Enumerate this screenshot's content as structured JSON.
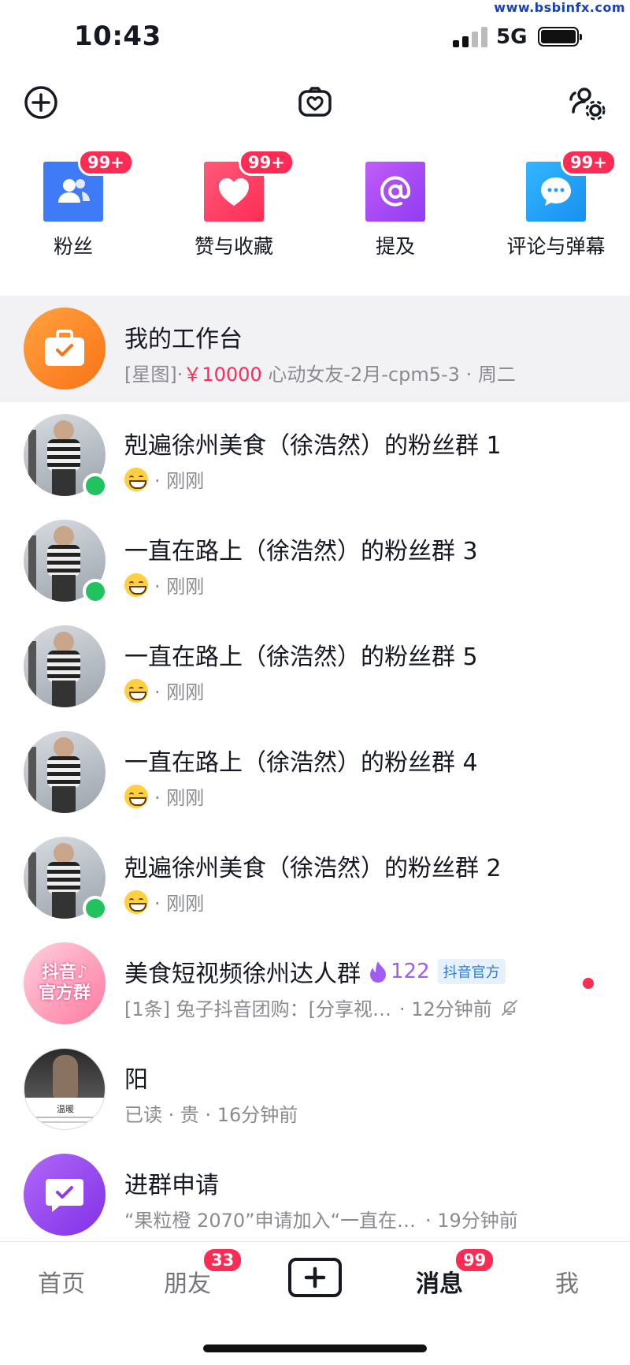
{
  "watermark": "www.bsbinfx.com",
  "status_bar": {
    "time": "10:43",
    "network": "5G"
  },
  "categories": [
    {
      "label": "粉丝",
      "badge": "99+",
      "icon": "fans-icon",
      "color": "#3f7bf6"
    },
    {
      "label": "赞与收藏",
      "badge": "99+",
      "icon": "heart-icon",
      "color": "#fe2c55"
    },
    {
      "label": "提及",
      "badge": "",
      "icon": "at-icon",
      "color": "#a94cf5"
    },
    {
      "label": "评论与弹幕",
      "badge": "99+",
      "icon": "comment-icon",
      "color": "#21a0f6"
    }
  ],
  "workbench": {
    "title": "我的工作台",
    "sub_prefix": "[星图]·",
    "sub_price": "￥10000",
    "sub_rest": " 心动女友-2月-cpm5-3 · 周二"
  },
  "conversations": [
    {
      "title": "剋遍徐州美食（徐浩然）的粉丝群 1",
      "time": "· 刚刚",
      "online": true
    },
    {
      "title": "一直在路上（徐浩然）的粉丝群 3",
      "time": "· 刚刚",
      "online": true
    },
    {
      "title": "一直在路上（徐浩然）的粉丝群 5",
      "time": "· 刚刚",
      "online": false
    },
    {
      "title": "一直在路上（徐浩然）的粉丝群 4",
      "time": "· 刚刚",
      "online": false
    },
    {
      "title": "剋遍徐州美食（徐浩然）的粉丝群 2",
      "time": "· 刚刚",
      "online": true
    }
  ],
  "official_group": {
    "title": "美食短视频徐州达人群",
    "count": "122",
    "tag": "抖音官方",
    "avatar_text_1": "抖音♪",
    "avatar_text_2": "官方群",
    "preview": "[1条] 兔子抖音团购：[分享视…",
    "time": "· 12分钟前"
  },
  "yang": {
    "title": "阳",
    "preview": "已读 · 贵 · 16分钟前",
    "avatar_caption": "温暖"
  },
  "join_request": {
    "title": "进群申请",
    "preview": "“果粒橙 2070”申请加入“一直在…",
    "time": "· 19分钟前"
  },
  "nav": {
    "home": "首页",
    "friends": "朋友",
    "friends_badge": "33",
    "messages": "消息",
    "messages_badge": "99",
    "me": "我"
  }
}
